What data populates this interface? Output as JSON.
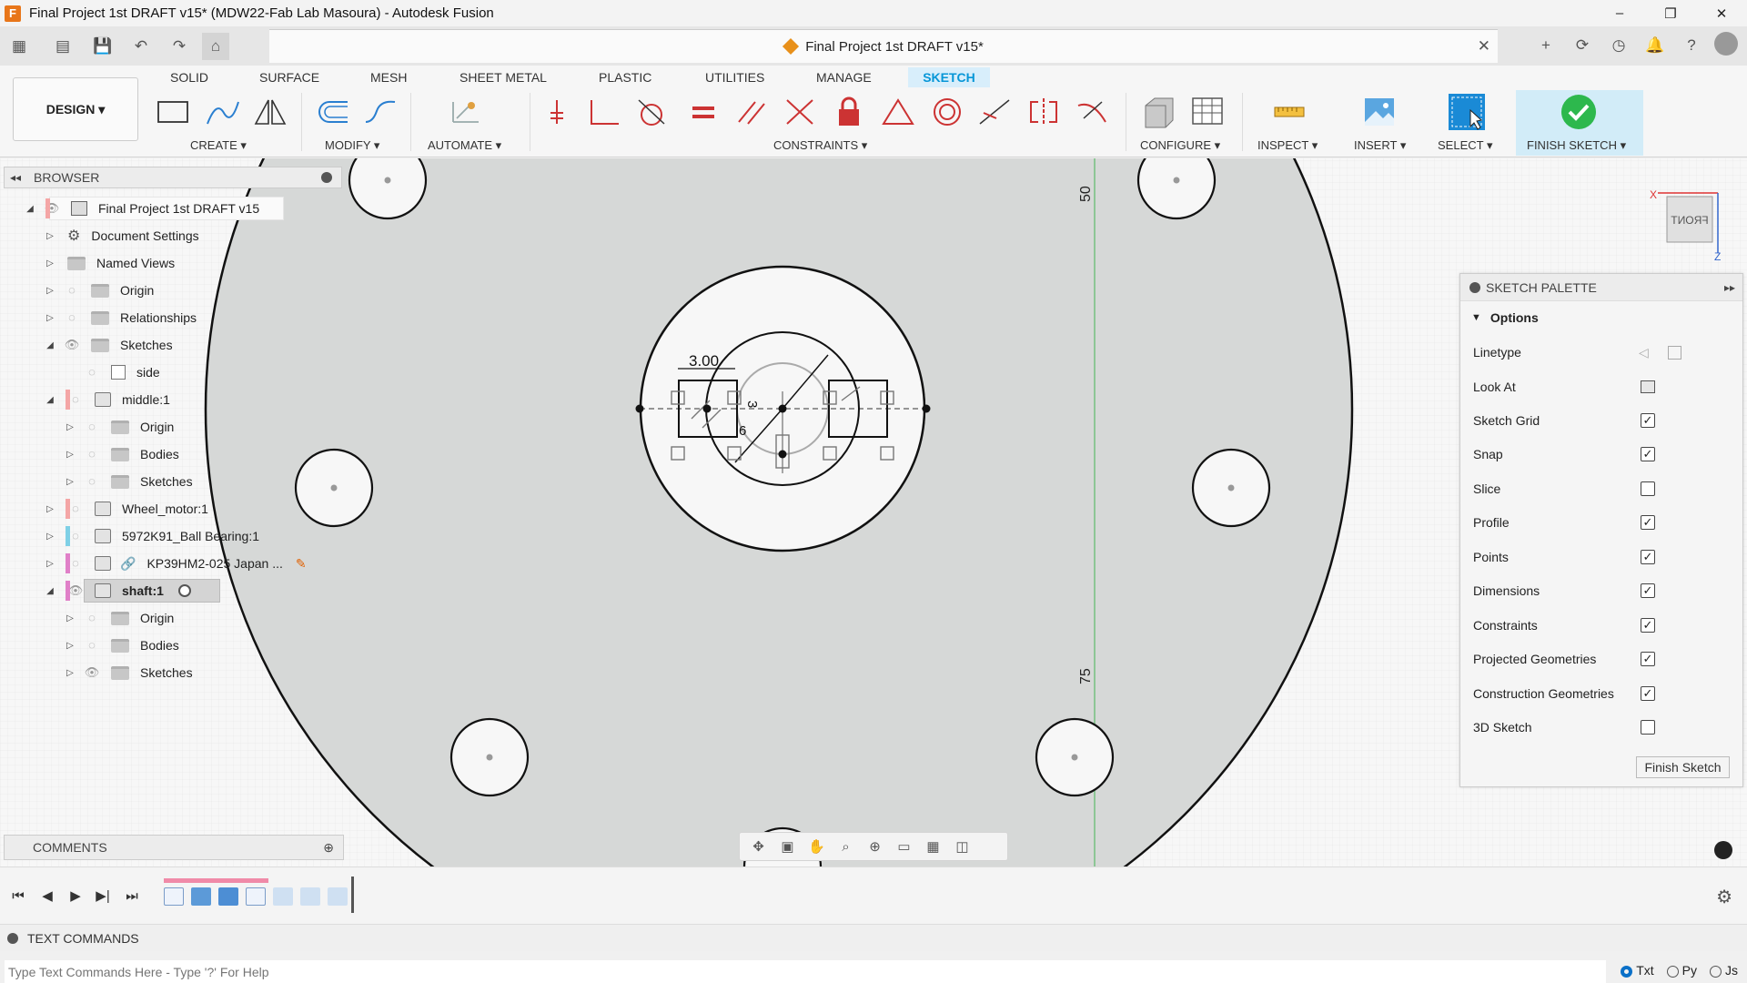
{
  "window": {
    "title": "Final Project 1st DRAFT v15* (MDW22-Fab Lab Masoura) - Autodesk Fusion",
    "minimize": "–",
    "restore": "❐",
    "close": "✕"
  },
  "document_tab": {
    "label": "Final Project 1st DRAFT v15*",
    "close": "✕"
  },
  "ribbon": {
    "design_button": "DESIGN ▾",
    "tabs": [
      "SOLID",
      "SURFACE",
      "MESH",
      "SHEET METAL",
      "PLASTIC",
      "UTILITIES",
      "MANAGE",
      "SKETCH"
    ],
    "active_tab": "SKETCH",
    "groups": {
      "create": "CREATE ▾",
      "modify": "MODIFY ▾",
      "automate": "AUTOMATE ▾",
      "constraints": "CONSTRAINTS ▾",
      "configure": "CONFIGURE ▾",
      "inspect": "INSPECT ▾",
      "insert": "INSERT ▾",
      "select": "SELECT ▾",
      "finish_sketch": "FINISH SKETCH ▾"
    }
  },
  "browser": {
    "title": "BROWSER",
    "items": [
      {
        "label": "Final Project 1st DRAFT v15",
        "icon": "document-icon"
      },
      {
        "label": "Document Settings",
        "icon": "gear-icon"
      },
      {
        "label": "Named Views",
        "icon": "folder-icon"
      },
      {
        "label": "Origin",
        "icon": "folder-icon"
      },
      {
        "label": "Relationships",
        "icon": "folder-icon"
      },
      {
        "label": "Sketches",
        "icon": "folder-icon"
      },
      {
        "label": "side",
        "icon": "sketch-icon"
      },
      {
        "label": "middle:1",
        "icon": "component-icon"
      },
      {
        "label": "Origin",
        "icon": "folder-icon"
      },
      {
        "label": "Bodies",
        "icon": "folder-icon"
      },
      {
        "label": "Sketches",
        "icon": "folder-icon"
      },
      {
        "label": "Wheel_motor:1",
        "icon": "component-icon"
      },
      {
        "label": "5972K91_Ball Bearing:1",
        "icon": "component-icon"
      },
      {
        "label": "KP39HM2-025 Japan ...",
        "icon": "link-icon"
      },
      {
        "label": "shaft:1",
        "icon": "component-icon"
      },
      {
        "label": "Origin",
        "icon": "folder-icon"
      },
      {
        "label": "Bodies",
        "icon": "folder-icon"
      },
      {
        "label": "Sketches",
        "icon": "folder-icon"
      }
    ]
  },
  "comments": {
    "title": "COMMENTS"
  },
  "canvas": {
    "dimension_300": "3.00",
    "dimension_3": "3",
    "dimension_6": "6",
    "axis_50": "50",
    "axis_75": "75",
    "viewcube_label": "FRONT",
    "axis_x": "X",
    "axis_z": "Z"
  },
  "sketch_palette": {
    "title": "SKETCH PALETTE",
    "section": "Options",
    "rows": [
      {
        "label": "Linetype",
        "type": "icons"
      },
      {
        "label": "Look At",
        "type": "icon"
      },
      {
        "label": "Sketch Grid",
        "checked": true
      },
      {
        "label": "Snap",
        "checked": true
      },
      {
        "label": "Slice",
        "checked": false
      },
      {
        "label": "Profile",
        "checked": true
      },
      {
        "label": "Points",
        "checked": true
      },
      {
        "label": "Dimensions",
        "checked": true
      },
      {
        "label": "Constraints",
        "checked": true
      },
      {
        "label": "Projected Geometries",
        "checked": true
      },
      {
        "label": "Construction Geometries",
        "checked": true
      },
      {
        "label": "3D Sketch",
        "checked": false
      }
    ],
    "finish_button": "Finish Sketch"
  },
  "text_commands": {
    "title": "TEXT COMMANDS",
    "placeholder": "Type Text Commands Here - Type '?' For Help",
    "modes": [
      "Txt",
      "Py",
      "Js"
    ],
    "selected_mode": "Txt"
  },
  "colors": {
    "accent": "#0696d7",
    "active_tab_bg": "#d8eefb",
    "finish_green": "#2db84d",
    "canvas_fill": "#d6d8d7"
  }
}
